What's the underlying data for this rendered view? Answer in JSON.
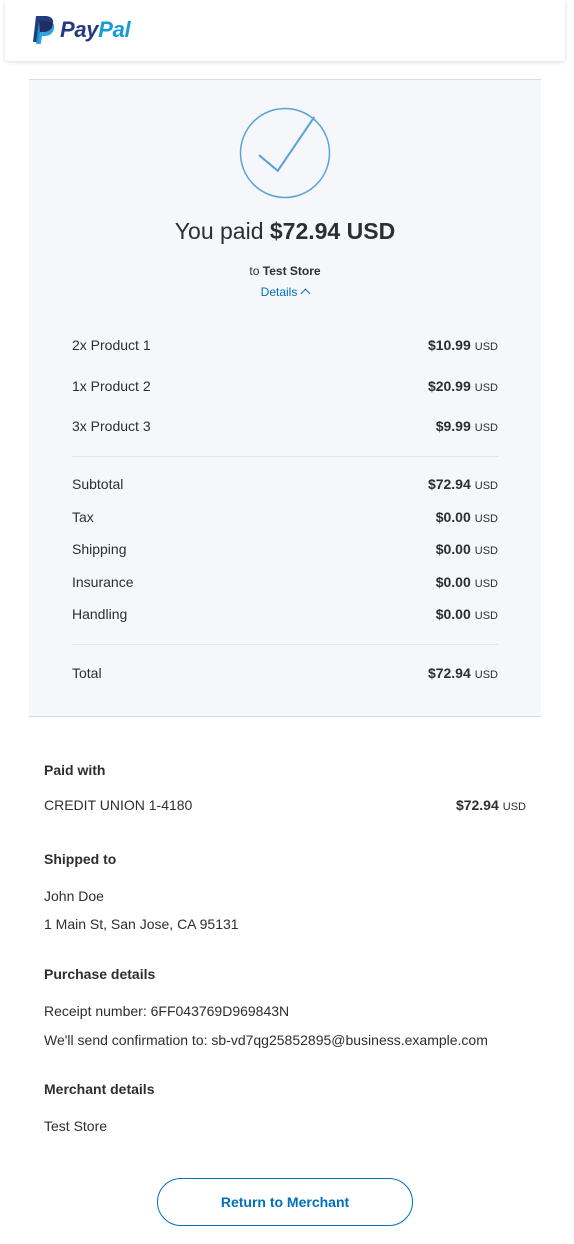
{
  "brand": {
    "name_part1": "Pay",
    "name_part2": "Pal",
    "colors": {
      "dark_blue": "#253b80",
      "light_blue": "#179bd7",
      "link": "#0070ba"
    }
  },
  "summary": {
    "paid_prefix": "You paid",
    "paid_amount": "$72.94 USD",
    "to_prefix": "to",
    "to_store": "Test Store",
    "details_label": "Details",
    "items": [
      {
        "label": "2x Product 1",
        "amount": "$10.99",
        "currency": "USD"
      },
      {
        "label": "1x Product 2",
        "amount": "$20.99",
        "currency": "USD"
      },
      {
        "label": "3x Product 3",
        "amount": "$9.99",
        "currency": "USD"
      }
    ],
    "breakdown": [
      {
        "label": "Subtotal",
        "amount": "$72.94",
        "currency": "USD"
      },
      {
        "label": "Tax",
        "amount": "$0.00",
        "currency": "USD"
      },
      {
        "label": "Shipping",
        "amount": "$0.00",
        "currency": "USD"
      },
      {
        "label": "Insurance",
        "amount": "$0.00",
        "currency": "USD"
      },
      {
        "label": "Handling",
        "amount": "$0.00",
        "currency": "USD"
      }
    ],
    "total": {
      "label": "Total",
      "amount": "$72.94",
      "currency": "USD"
    }
  },
  "paid_with": {
    "heading": "Paid with",
    "method": "CREDIT UNION 1-4180",
    "amount": "$72.94",
    "currency": "USD"
  },
  "shipped_to": {
    "heading": "Shipped to",
    "name": "John Doe",
    "address": "1 Main St, San Jose, CA 95131"
  },
  "purchase_details": {
    "heading": "Purchase details",
    "receipt": "Receipt number: 6FF043769D969843N",
    "confirmation": "We'll send confirmation to: sb-vd7qg25852895@business.example.com"
  },
  "merchant_details": {
    "heading": "Merchant details",
    "name": "Test Store"
  },
  "actions": {
    "return_label": "Return to Merchant"
  }
}
